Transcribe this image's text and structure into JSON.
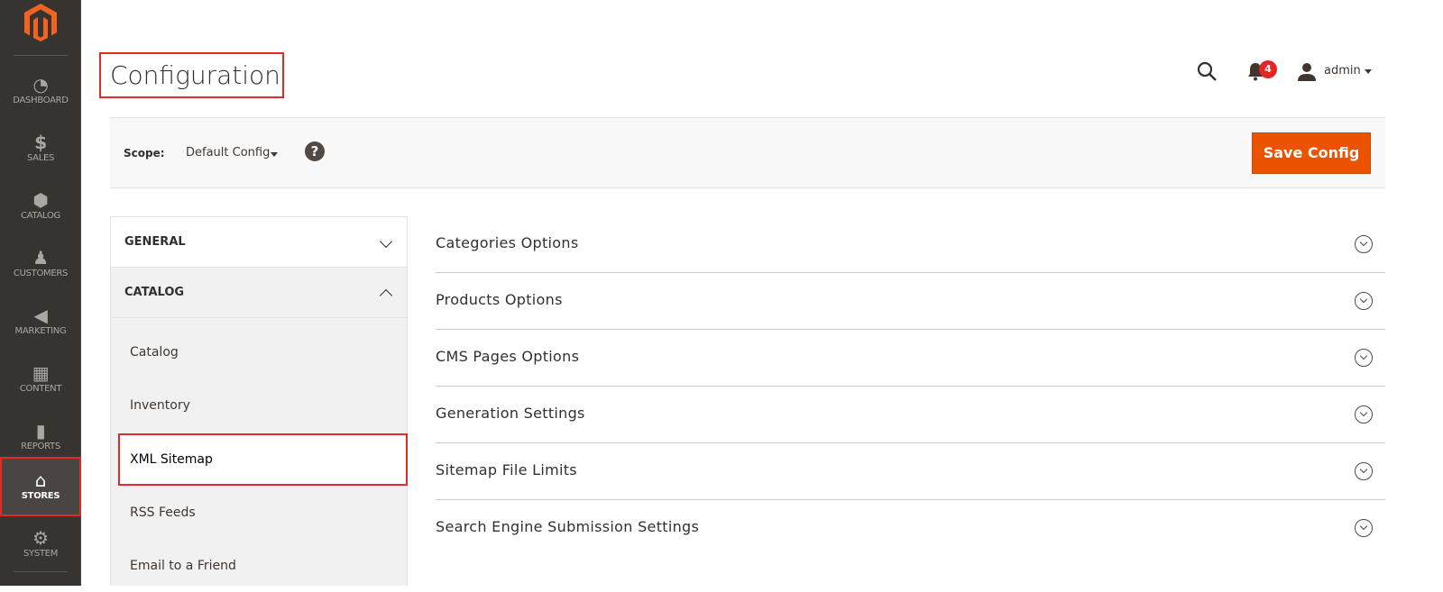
{
  "sidebar": {
    "items": [
      {
        "label": "DASHBOARD",
        "icon": "dashboard-icon"
      },
      {
        "label": "SALES",
        "icon": "dollar-icon"
      },
      {
        "label": "CATALOG",
        "icon": "box-icon"
      },
      {
        "label": "CUSTOMERS",
        "icon": "person-icon"
      },
      {
        "label": "MARKETING",
        "icon": "megaphone-icon"
      },
      {
        "label": "CONTENT",
        "icon": "layout-icon"
      },
      {
        "label": "REPORTS",
        "icon": "bar-chart-icon"
      },
      {
        "label": "STORES",
        "icon": "store-icon",
        "active": true
      },
      {
        "label": "SYSTEM",
        "icon": "gear-icon"
      }
    ]
  },
  "header": {
    "title": "Configuration",
    "notifications": "4",
    "user": "admin"
  },
  "scope": {
    "label": "Scope:",
    "value": "Default Config",
    "help": "?",
    "save": "Save Config"
  },
  "leftnav": {
    "groups": [
      {
        "label": "GENERAL",
        "expanded": false
      },
      {
        "label": "CATALOG",
        "expanded": true
      }
    ],
    "items": [
      "Catalog",
      "Inventory",
      "XML Sitemap",
      "RSS Feeds",
      "Email to a Friend"
    ],
    "active": "XML Sitemap"
  },
  "sections": [
    "Categories Options",
    "Products Options",
    "CMS Pages Options",
    "Generation Settings",
    "Sitemap File Limits",
    "Search Engine Submission Settings"
  ],
  "colors": {
    "accent": "#eb5202",
    "sidebar": "#373330",
    "highlight": "#e02b27"
  }
}
